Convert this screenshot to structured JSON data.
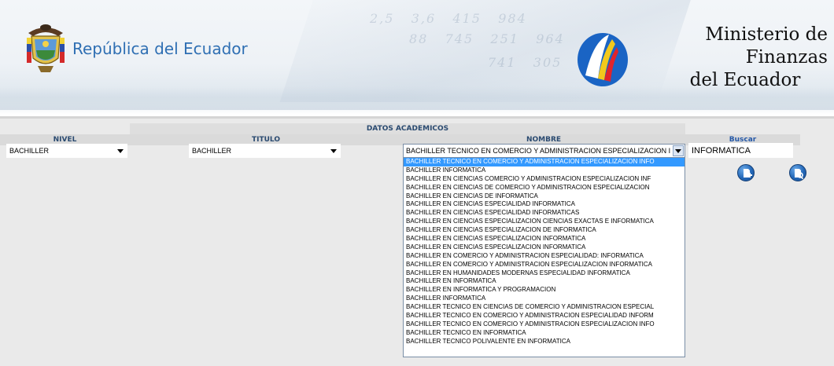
{
  "header": {
    "republic_title": "República del Ecuador",
    "ministry_title_line1": "Ministerio de Finanzas",
    "ministry_title_line2": "del Ecuador",
    "coat_of_arms_icon": "coat-of-arms-icon",
    "ministry_logo_icon": "ministry-logo-icon"
  },
  "form": {
    "section_title": "DATOS ACADEMICOS",
    "columns": {
      "nivel": "NIVEL",
      "titulo": "TITULO",
      "nombre": "NOMBRE",
      "buscar": "Buscar"
    },
    "nivel_value": "BACHILLER",
    "titulo_value": "BACHILLER",
    "nombre_value": "BACHILLER TECNICO EN COMERCIO Y ADMINISTRACION ESPECIALIZACION I",
    "search_value": "INFORMATICA",
    "new_icon": "new-document-icon",
    "search_icon": "search-document-icon"
  },
  "dropdown": {
    "selected_index": 0,
    "options": [
      "BACHILLER TECNICO EN COMERCIO Y ADMINISTRACION ESPECIALIZACION INFO",
      "BACHILLER INFORMATICA",
      "BACHILLER EN CIENCIAS COMERCIO Y ADMINISTRACION ESPECIALIZACION INF",
      "BACHILLER EN CIENCIAS DE COMERCIO Y ADMINISTRACION ESPECIALIZACION",
      "BACHILLER EN CIENCIAS DE INFORMATICA",
      "BACHILLER EN CIENCIAS ESPECIALIDAD INFORMATICA",
      "BACHILLER EN CIENCIAS ESPECIALIDAD INFORMATICAS",
      "BACHILLER EN CIENCIAS ESPECIALIZACION CIENCIAS EXACTAS E INFORMATICA",
      "BACHILLER EN CIENCIAS ESPECIALIZACION DE INFORMATICA",
      "BACHILLER EN CIENCIAS ESPECIALIZACION INFORMATICA",
      "BACHILLER EN CIENCIAS ESPECIALIZACION INFORMATICA",
      "BACHILLER EN COMERCIO Y ADMINISTRACION ESPECIALIDAD: INFORMATICA",
      "BACHILLER EN COMERCIO Y ADMINISTRACION ESPECIALIZACION INFORMATICA",
      "BACHILLER EN HUMANIDADES MODERNAS ESPECIALIDAD INFORMATICA",
      "BACHILLER EN INFORMATICA",
      "BACHILLER EN INFORMATICA Y PROGRAMACION",
      "BACHILLER INFORMATICA",
      "BACHILLER TECNICO EN CIENCIAS DE COMERCIO Y ADMINISTRACION ESPECIAL",
      "BACHILLER TECNICO EN COMERCIO Y ADMINISTRACION ESPECIALIDAD INFORM",
      "BACHILLER TECNICO EN COMERCIO Y ADMINISTRACION ESPECIALIZACION INFO",
      "BACHILLER TECNICO EN INFORMATICA",
      "BACHILLER TECNICO POLIVALENTE EN INFORMATICA"
    ]
  },
  "colors": {
    "header_text_blue": "#2f6fb3",
    "label_blue": "#2457a6",
    "selection_blue": "#3399ff",
    "form_background": "#eaeaea"
  }
}
